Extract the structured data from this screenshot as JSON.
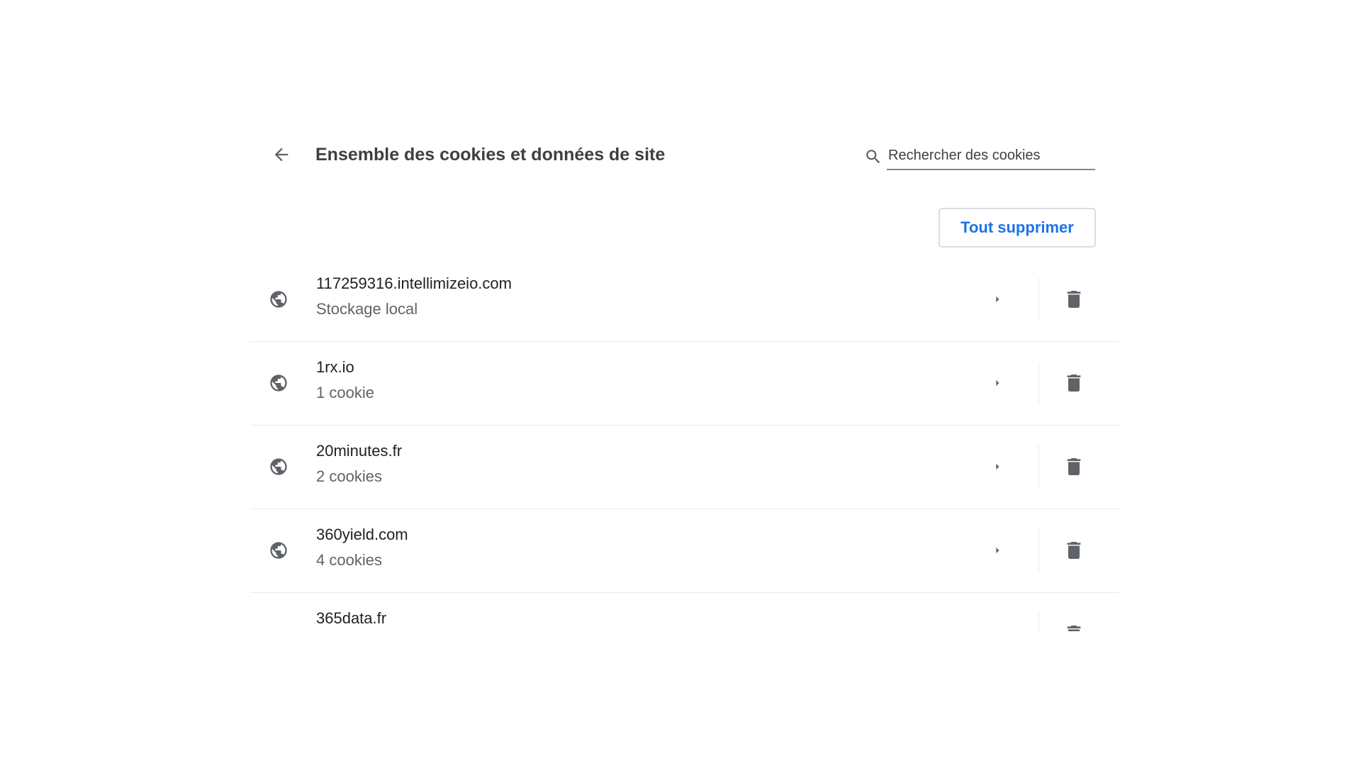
{
  "header": {
    "title": "Ensemble des cookies et données de site",
    "back_icon": "arrow-back-icon"
  },
  "search": {
    "placeholder": "Rechercher des cookies",
    "value": "",
    "icon": "search-icon"
  },
  "toolbar": {
    "remove_all_label": "Tout supprimer"
  },
  "colors": {
    "accent": "#1a73e8",
    "icon_gray": "#5f6368",
    "favicon_orange": "#f29900"
  },
  "sites": [
    {
      "name": "117259316.intellimizeio.com",
      "detail": "Stockage local",
      "icon": "globe-icon"
    },
    {
      "name": "1rx.io",
      "detail": "1 cookie",
      "icon": "globe-icon"
    },
    {
      "name": "20minutes.fr",
      "detail": "2 cookies",
      "icon": "globe-icon"
    },
    {
      "name": "360yield.com",
      "detail": "4 cookies",
      "icon": "globe-icon"
    },
    {
      "name": "365data.fr",
      "detail": "",
      "icon": "site-favicon-icon"
    }
  ]
}
